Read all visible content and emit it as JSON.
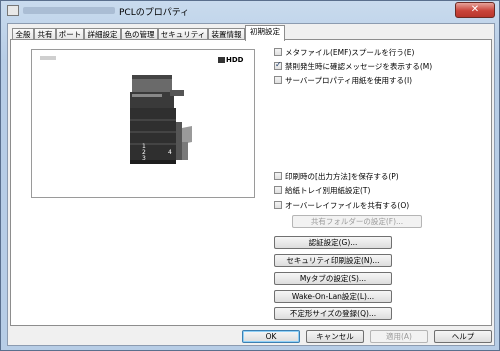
{
  "window": {
    "title": "PCLのプロパティ",
    "close_label": "✕"
  },
  "tabs": [
    {
      "label": "全般"
    },
    {
      "label": "共有"
    },
    {
      "label": "ポート"
    },
    {
      "label": "詳細設定"
    },
    {
      "label": "色の管理"
    },
    {
      "label": "セキュリティ"
    },
    {
      "label": "装置情報"
    },
    {
      "label": "初期設定"
    }
  ],
  "preview": {
    "hdd_label": "HDD",
    "tray_numbers": [
      "1",
      "2",
      "3",
      "4"
    ]
  },
  "options_top": [
    {
      "label": "メタファイル(EMF)スプールを行う(E)",
      "checked": false
    },
    {
      "label": "禁則発生時に確認メッセージを表示する(M)",
      "checked": true
    },
    {
      "label": "サーバープロパティ用紙を使用する(I)",
      "checked": false
    }
  ],
  "options_bottom": [
    {
      "label": "印刷時の[出力方法]を保存する(P)",
      "checked": false
    },
    {
      "label": "給紙トレイ別用紙設定(T)",
      "checked": false
    },
    {
      "label": "オーバーレイファイルを共有する(O)",
      "checked": false
    }
  ],
  "shared_folder_button": "共有フォルダーの設定(F)...",
  "setting_buttons": [
    {
      "label": "認証設定(G)..."
    },
    {
      "label": "セキュリティ印刷設定(N)..."
    },
    {
      "label": "Myタブの設定(S)..."
    },
    {
      "label": "Wake-On-Lan設定(L)..."
    },
    {
      "label": "不定形サイズの登録(Q)..."
    }
  ],
  "dialog_buttons": {
    "ok": "OK",
    "cancel": "キャンセル",
    "apply": "適用(A)",
    "help": "ヘルプ"
  }
}
